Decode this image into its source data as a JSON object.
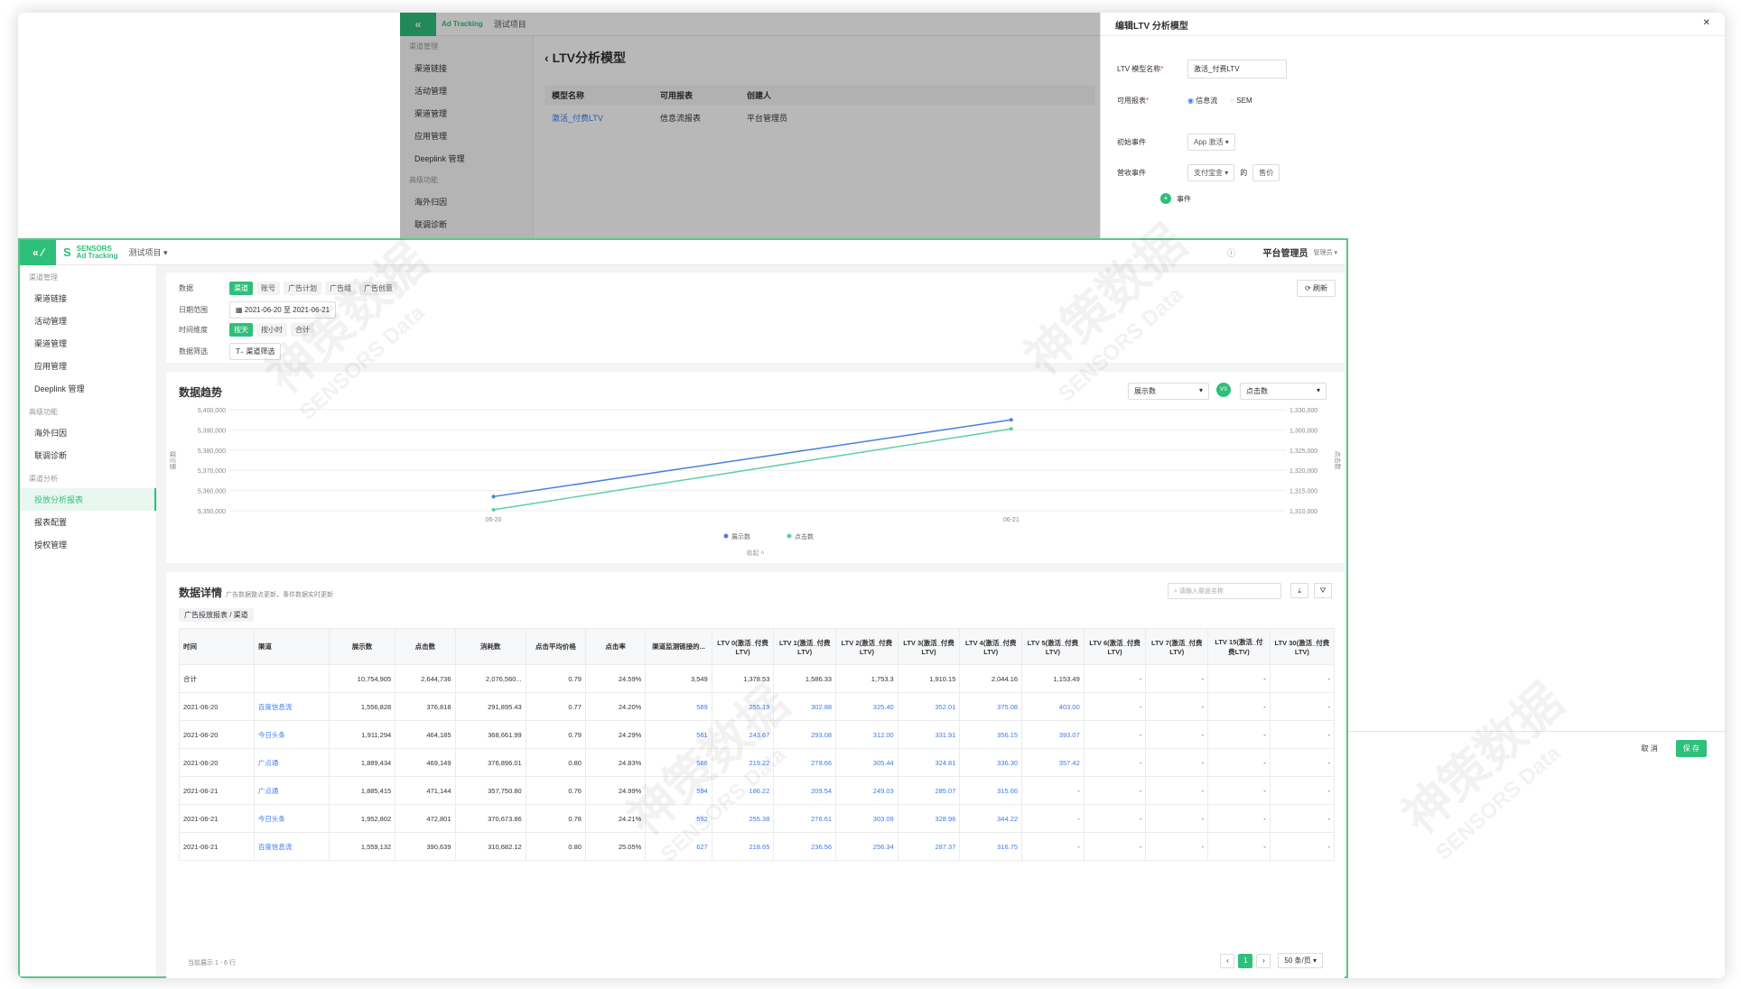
{
  "back_window": {
    "project": "测试项目",
    "nav_group": "渠道管理",
    "nav_items": [
      "渠道链接",
      "活动管理",
      "渠道管理",
      "应用管理",
      "Deeplink 管理"
    ],
    "nav_group2": "高级功能",
    "nav_items2": [
      "海外归因",
      "联调诊断"
    ],
    "page_title": "LTV分析模型",
    "table_headers": [
      "模型名称",
      "可用报表",
      "创建人"
    ],
    "table_row": [
      "激活_付费LTV",
      "信息流报表",
      "平台管理员"
    ]
  },
  "drawer": {
    "title": "编辑LTV 分析模型",
    "name_label": "LTV 模型名称",
    "name_value": "激活_付费LTV",
    "report_label": "可用报表",
    "report_opts": [
      "信息流",
      "SEM"
    ],
    "init_label": "初始事件",
    "init_value": "App 激活",
    "revenue_label": "营收事件",
    "revenue_event": "支付宝金",
    "revenue_of": "的",
    "revenue_prop": "售价",
    "add_event": "事件",
    "cancel": "取 消",
    "save": "保 存"
  },
  "front": {
    "brand_line1": "SENSORS",
    "brand_line2": "Ad Tracking",
    "project": "测试项目",
    "user": "平台管理员",
    "role": "管理员",
    "nav": [
      {
        "type": "group",
        "label": "渠道管理"
      },
      {
        "type": "item",
        "label": "渠道链接"
      },
      {
        "type": "item",
        "label": "活动管理"
      },
      {
        "type": "item",
        "label": "渠道管理"
      },
      {
        "type": "item",
        "label": "应用管理"
      },
      {
        "type": "item",
        "label": "Deeplink 管理"
      },
      {
        "type": "group",
        "label": "高级功能"
      },
      {
        "type": "item",
        "label": "海外归因"
      },
      {
        "type": "item",
        "label": "联调诊断"
      },
      {
        "type": "group",
        "label": "渠道分析"
      },
      {
        "type": "item",
        "label": "投放分析报表",
        "active": true
      },
      {
        "type": "item",
        "label": "报表配置"
      },
      {
        "type": "item",
        "label": "授权管理"
      }
    ],
    "filters": {
      "data_label": "数据",
      "data_tags": [
        "渠道",
        "账号",
        "广告计划",
        "广告组",
        "广告创意"
      ],
      "date_label": "日期范围",
      "date_value": "2021-06-20 至 2021-06-21",
      "dim_label": "时间维度",
      "dim_tags": [
        "按天",
        "按小时",
        "合计"
      ],
      "filter_label": "数据筛选",
      "filter_btn": "渠道筛选",
      "refresh": "刷新"
    },
    "trend": {
      "title": "数据趋势",
      "left_metric": "展示数",
      "vs": "VS",
      "right_metric": "点击数",
      "collapse": "收起"
    },
    "detail": {
      "title": "数据详情",
      "subtitle": "广告数据整点更新，事件数据实时更新",
      "search_placeholder": "请输入渠道名称",
      "breadcrumb": [
        "广告投放报表",
        "渠道"
      ],
      "headers": [
        "时间",
        "渠道",
        "展示数",
        "点击数",
        "消耗数",
        "点击平均价格",
        "点击率",
        "渠道监测链接的...",
        "LTV 0(激活_付费LTV)",
        "LTV 1(激活_付费LTV)",
        "LTV 2(激活_付费LTV)",
        "LTV 3(激活_付费LTV)",
        "LTV 4(激活_付费LTV)",
        "LTV 5(激活_付费LTV)",
        "LTV 6(激活_付费LTV)",
        "LTV 7(激活_付费LTV)",
        "LTV 15(激活_付费LTV)",
        "LTV 30(激活_付费LTV)"
      ],
      "rows": [
        [
          "合计",
          "",
          "10,754,905",
          "2,644,736",
          "2,076,560...",
          "0.79",
          "24.59%",
          "3,549",
          "1,378.53",
          "1,586.33",
          "1,753.3",
          "1,910.15",
          "2,044.16",
          "1,153.49",
          "-",
          "-",
          "-",
          "-"
        ],
        [
          "2021-06-20",
          "百度信息流",
          "1,556,828",
          "376,818",
          "291,895.43",
          "0.77",
          "24.20%",
          "589",
          "255.19",
          "302.88",
          "325.40",
          "352.01",
          "375.08",
          "403.00",
          "-",
          "-",
          "-",
          "-"
        ],
        [
          "2021-06-20",
          "今日头条",
          "1,911,294",
          "464,185",
          "368,661.99",
          "0.79",
          "24.29%",
          "561",
          "243.67",
          "293.08",
          "312.00",
          "331.91",
          "356.15",
          "393.07",
          "-",
          "-",
          "-",
          "-"
        ],
        [
          "2021-06-20",
          "广点通",
          "1,889,434",
          "469,149",
          "376,896.01",
          "0.80",
          "24.83%",
          "586",
          "219.22",
          "279.66",
          "305.44",
          "324.81",
          "336.30",
          "357.42",
          "-",
          "-",
          "-",
          "-"
        ],
        [
          "2021-06-21",
          "广点通",
          "1,885,415",
          "471,144",
          "357,750.80",
          "0.76",
          "24.99%",
          "594",
          "186.22",
          "209.54",
          "249.03",
          "285.07",
          "315.66",
          "-",
          "-",
          "-",
          "-",
          "-"
        ],
        [
          "2021-06-21",
          "今日头条",
          "1,952,802",
          "472,801",
          "370,673.86",
          "0.78",
          "24.21%",
          "592",
          "255.38",
          "276.61",
          "303.09",
          "328.96",
          "344.22",
          "-",
          "-",
          "-",
          "-",
          "-"
        ],
        [
          "2021-06-21",
          "百度信息流",
          "1,559,132",
          "390,639",
          "310,682.12",
          "0.80",
          "25.05%",
          "627",
          "218.65",
          "236.56",
          "256.34",
          "287.37",
          "316.75",
          "-",
          "-",
          "-",
          "-",
          "-"
        ]
      ],
      "footer": "当前展示 1 - 6 行",
      "page": "1",
      "page_size": "50 条/页"
    }
  },
  "chart_data": {
    "type": "line",
    "x": [
      "06-20",
      "06-21"
    ],
    "series": [
      {
        "name": "展示数",
        "axis": "left",
        "values": [
          5357000,
          5395000
        ],
        "color": "#4a7fe0"
      },
      {
        "name": "点击数",
        "axis": "right",
        "values": [
          1310200,
          1326200
        ],
        "color": "#5ccfa8"
      }
    ],
    "ylim_left": [
      5350000,
      5400000
    ],
    "yticks_left": [
      "5,400,000",
      "5,390,000",
      "5,380,000",
      "5,370,000",
      "5,360,000",
      "5,350,000"
    ],
    "ylim_right": [
      1310000,
      1330000
    ],
    "yticks_right": [
      "1,330,000",
      "1,300,000",
      "1,325,000",
      "1,320,000",
      "1,315,000",
      "1,310,000"
    ],
    "ylabel_left": "展示数",
    "ylabel_right": "点击数",
    "legend": "bottom-center",
    "grid": true
  }
}
